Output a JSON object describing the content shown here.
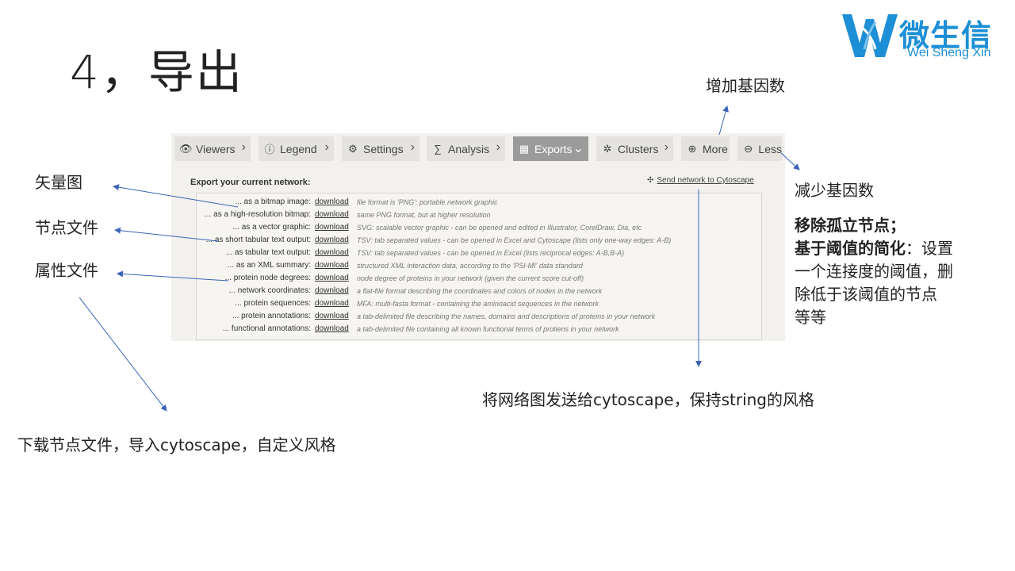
{
  "slide": {
    "title": "4，导出"
  },
  "logo": {
    "cn": "微生信",
    "en": "Wei Sheng Xin"
  },
  "tabs": [
    {
      "label": "Viewers",
      "icon": "eye-icon",
      "glyph": "👁",
      "chev": "›"
    },
    {
      "label": "Legend",
      "icon": "info-icon",
      "glyph": "ⓘ",
      "chev": "›"
    },
    {
      "label": "Settings",
      "icon": "gear-icon",
      "glyph": "⚙",
      "chev": "›"
    },
    {
      "label": "Analysis",
      "icon": "sigma-icon",
      "glyph": "∑",
      "chev": "›"
    },
    {
      "label": "Exports",
      "icon": "table-icon",
      "glyph": "▦",
      "chev": "⌄"
    },
    {
      "label": "Clusters",
      "icon": "cluster-icon",
      "glyph": "✲",
      "chev": "›"
    },
    {
      "label": "More",
      "icon": "plus-icon",
      "glyph": "⊕",
      "chev": ""
    },
    {
      "label": "Less",
      "icon": "minus-icon",
      "glyph": "⊖",
      "chev": ""
    }
  ],
  "export": {
    "heading": "Export your current network:",
    "cytoscape_link": "Send network to Cytoscape",
    "download_label": "download",
    "rows": [
      {
        "label": "... as a bitmap image:",
        "desc": "file format is 'PNG': portable network graphic"
      },
      {
        "label": "... as a high-resolution bitmap:",
        "desc": "same PNG format, but at higher resolution"
      },
      {
        "label": "... as a vector graphic:",
        "desc": "SVG: scalable vector graphic - can be opened and edited in Illustrator, CorelDraw, Dia, etc"
      },
      {
        "label": "... as short tabular text output:",
        "desc": "TSV: tab separated values - can be opened in Excel and Cytoscape (lists only one-way edges: A-B)"
      },
      {
        "label": "... as tabular text output:",
        "desc": "TSV: tab separated values - can be opened in Excel (lists reciprocal edges: A-B,B-A)"
      },
      {
        "label": "... as an XML summary:",
        "desc": "structured XML interaction data, according to the 'PSI-MI' data standard"
      },
      {
        "label": "... protein node degrees:",
        "desc": "node degree of proteins in your network (given the current score cut-off)"
      },
      {
        "label": "... network coordinates:",
        "desc": "a flat-file format describing the coordinates and colors of nodes in the network"
      },
      {
        "label": "... protein sequences:",
        "desc": "MFA: multi-fasta format - containing the aminoacid sequences in the network"
      },
      {
        "label": "... protein annotations:",
        "desc": "a tab-delimited file describing the names, domains and descriptions of proteins in your network"
      },
      {
        "label": "... functional annotations:",
        "desc": "a tab-delimited file containing all known functional terms of protiens in your network"
      }
    ]
  },
  "annotations": {
    "vector": "矢量图",
    "node_file": "节点文件",
    "attr_file": "属性文件",
    "more_genes": "增加基因数",
    "less_genes": "减少基因数",
    "remove_isolated": "移除孤立节点；",
    "threshold_bold": "基于阈值的简化",
    "threshold_rest": "：设置",
    "threshold_line2": "一个连接度的阈值，删",
    "threshold_line3": "除低于该阈值的节点",
    "threshold_line4": "等等",
    "cytoscape_note": "将网络图发送给cytoscape，保持string的风格",
    "download_note": "下载节点文件，导入cytoscape，自定义风格"
  }
}
